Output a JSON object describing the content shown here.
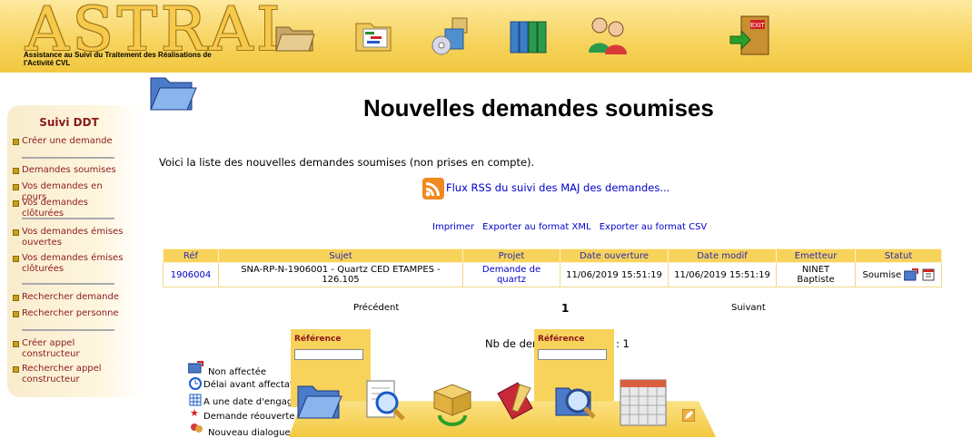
{
  "app": {
    "logo": "ASTRAL",
    "subtitle": "Assistance au Suivi du Traitement des Réalisations de l'Activité CVL"
  },
  "header_icons": [
    "folder-icon",
    "gantt-icon",
    "packages-icon",
    "binders-icon",
    "users-icon",
    "exit-icon"
  ],
  "sidebar": {
    "title": "Suivi DDT",
    "items": [
      {
        "label": "Créer une demande"
      },
      {
        "label": "Demandes soumises"
      },
      {
        "label": "Vos demandes en cours"
      },
      {
        "label": "Vos demandes clôturées"
      },
      {
        "label": "Vos demandes émises ouvertes"
      },
      {
        "label": "Vos demandes émises clôturées"
      },
      {
        "label": "Rechercher demande"
      },
      {
        "label": "Rechercher personne"
      },
      {
        "label": "Créer appel constructeur"
      },
      {
        "label": "Rechercher appel constructeur"
      }
    ]
  },
  "main": {
    "title": "Nouvelles demandes soumises",
    "intro": "Voici la liste des nouvelles demandes soumises (non prises en compte).",
    "rss_link": "Flux RSS du suivi des MAJ des demandes...",
    "exports": {
      "print": "Imprimer",
      "xml": "Exporter au format XML",
      "csv": "Exporter au format CSV"
    }
  },
  "table": {
    "headers": [
      "Réf",
      "Sujet",
      "Projet",
      "Date ouverture",
      "Date modif",
      "Emetteur",
      "Statut"
    ],
    "rows": [
      {
        "ref": "1906004",
        "sujet": "SNA-RP-N-1906001 - Quartz CED ETAMPES - 126.105",
        "projet": "Demande de quartz",
        "ouverture": "11/06/2019 15:51:19",
        "modif": "11/06/2019 15:51:19",
        "emetteur": "NINET Baptiste",
        "statut": "Soumise"
      }
    ]
  },
  "pager": {
    "prev": "Précédent",
    "page": "1",
    "next": "Suivant"
  },
  "count": {
    "label": "Nb de der",
    "value": ": 1"
  },
  "legend": [
    {
      "label": "Non affectée"
    },
    {
      "label": "Délai avant affectatio"
    },
    {
      "label": "A une date d'engage"
    },
    {
      "label": "Demande réouverte"
    },
    {
      "label": "Nouveau dialogue non lu"
    }
  ],
  "popups": [
    {
      "label": "Référence"
    },
    {
      "label": "Référence"
    }
  ],
  "dock_icons": [
    "open-folder-icon",
    "search-document-icon",
    "box-refresh-icon",
    "book-edit-icon",
    "search-magnifier-icon",
    "calendar-icon"
  ]
}
